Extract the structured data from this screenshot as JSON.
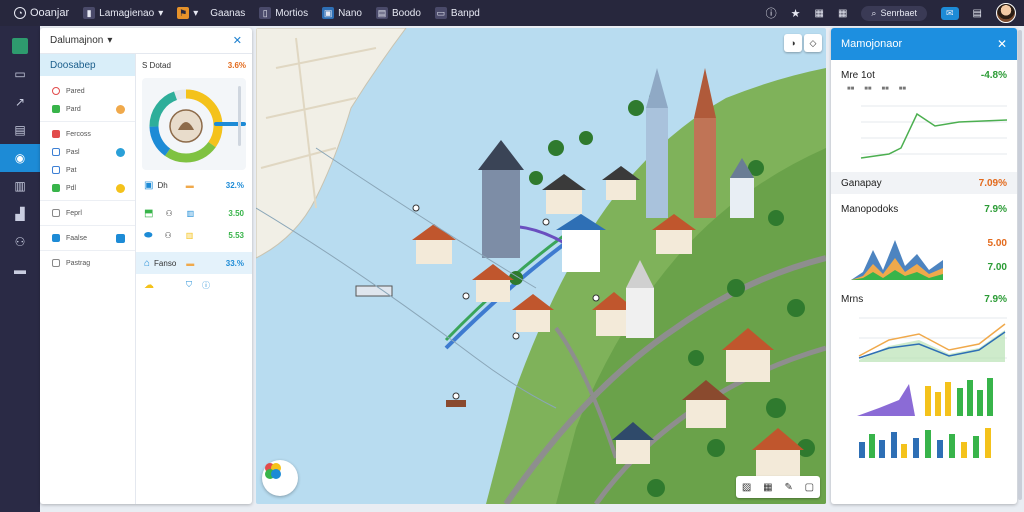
{
  "topbar": {
    "app_name": "Ooanjar",
    "menu_1": "Lamagienao",
    "menu_2": "Gaanas",
    "menu_3": "Mortios",
    "menu_4": "Nano",
    "menu_5": "Boodo",
    "menu_6": "Banpd",
    "search_label": "Senrbaet"
  },
  "sidebar": {
    "title": "Dalumajnon",
    "dashboard_label": "Doosabep",
    "items": [
      {
        "label": "Pared",
        "color": "#e24b4b"
      },
      {
        "label": "Pard",
        "color": "#38b44a",
        "dot": "#f0a94b"
      },
      {
        "label": "Fercoss",
        "color": "#e24b4b"
      },
      {
        "label": "Pasl",
        "color": "#3c7fd4",
        "dot": "#2aa0d8"
      },
      {
        "label": "Pat",
        "color": "#3c7fd4"
      },
      {
        "label": "Pdl",
        "color": "#38b44a",
        "dot": "#f4c21b"
      },
      {
        "label": "Feprl",
        "color": "#888888"
      },
      {
        "label": "Faalse",
        "color": "#1d8bd6",
        "dot": "#1d8bd6"
      },
      {
        "label": "Pastrag",
        "color": "#888888"
      }
    ],
    "stats": {
      "header_label": "S  Dotad",
      "header_value": "3.6%",
      "rows": [
        {
          "label": "Dh",
          "value": "32.%",
          "color": "#1d8bd6"
        },
        {
          "label": "",
          "value": "3.50",
          "color": "#38b44a"
        },
        {
          "label": "",
          "value": "5.53",
          "color": "#38b44a"
        },
        {
          "label": "Fanso",
          "value": "33.%",
          "color": "#1d8bd6"
        }
      ]
    }
  },
  "analytics": {
    "title": "Mamojonaor",
    "rows": [
      {
        "label": "Mre 1ot",
        "value": "-4.8%",
        "color": "#2a9b34"
      },
      {
        "label": "Ganapay",
        "value": "7.09%",
        "color": "#e36a1c"
      },
      {
        "label": "Manopodoks",
        "value": "7.9%",
        "color": "#2a9b34"
      },
      {
        "label": "Mrns",
        "value": "7.9%",
        "color": "#2a9b34"
      }
    ],
    "side_values": [
      "5.00",
      "7.00"
    ]
  },
  "colors": {
    "accent": "#1d8fe0",
    "topbar": "#27273d",
    "rail": "#2a2a45"
  }
}
